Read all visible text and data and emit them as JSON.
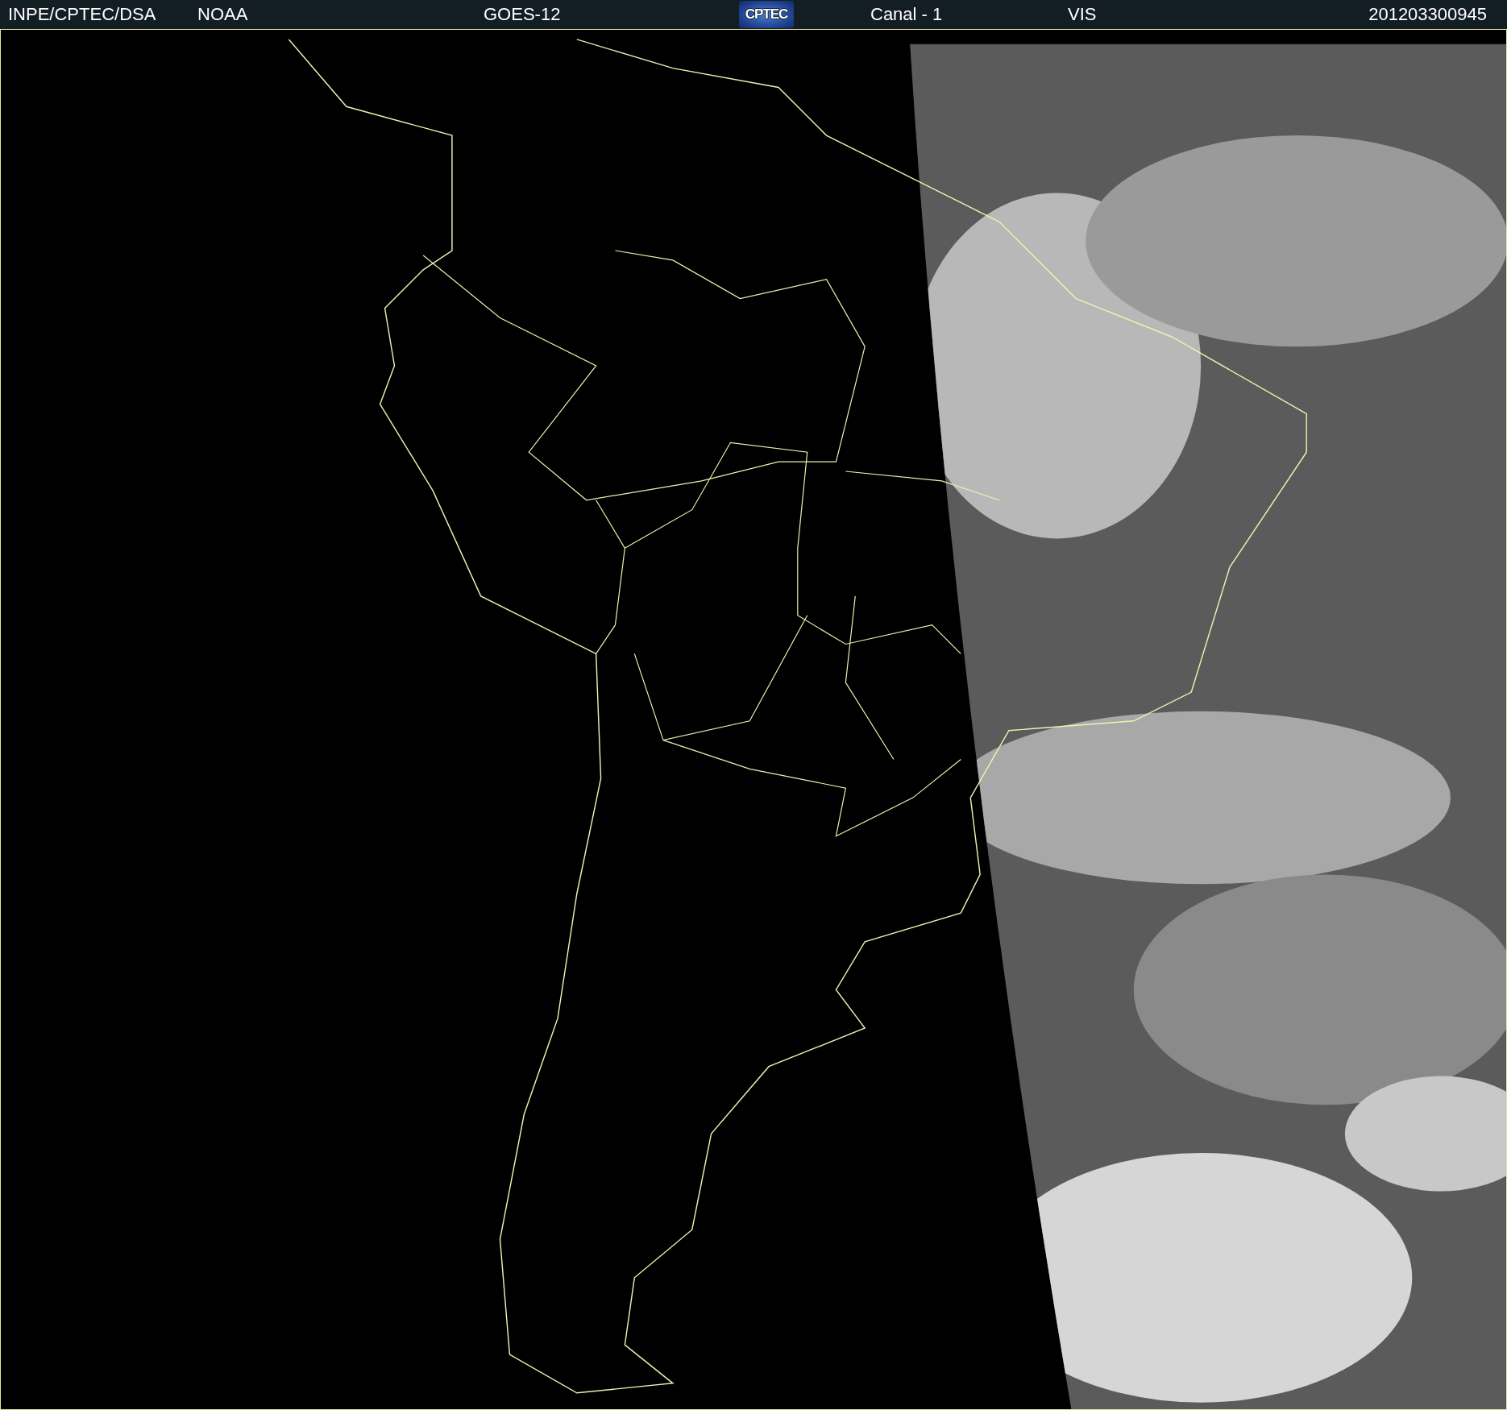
{
  "header": {
    "items": [
      {
        "kind": "text",
        "text": "INPE/CPTEC/DSA"
      },
      {
        "kind": "text",
        "text": "NOAA"
      },
      {
        "kind": "text",
        "text": "GOES-12"
      },
      {
        "kind": "logo",
        "text": "CPTEC"
      },
      {
        "kind": "text",
        "text": "Canal - 1"
      },
      {
        "kind": "text",
        "text": "VIS"
      },
      {
        "kind": "timestamp",
        "text": "201203300945"
      }
    ]
  }
}
